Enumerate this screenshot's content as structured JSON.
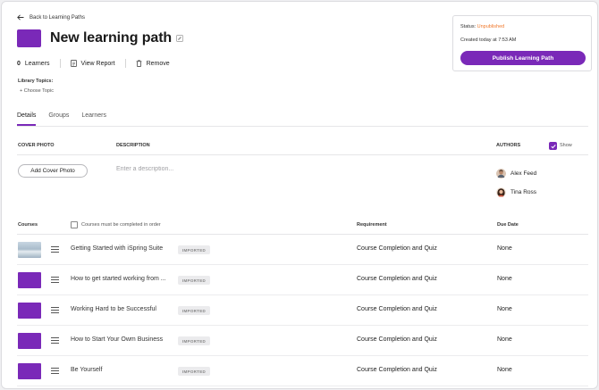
{
  "back_link": {
    "label": "Back to Learning Paths"
  },
  "title": "New learning path",
  "actions": {
    "learners_count": "0",
    "learners_label": "Learners",
    "view_report": "View Report",
    "remove": "Remove"
  },
  "library": {
    "label": "Library Topics:",
    "choose_topic": "+ Choose Topic"
  },
  "status_card": {
    "status_label": "Status:",
    "status_value": "Unpublished",
    "created": "Created today at 7:53 AM",
    "publish_button": "Publish Learning Path"
  },
  "tabs": [
    {
      "label": "Details",
      "active": true
    },
    {
      "label": "Groups",
      "active": false
    },
    {
      "label": "Learners",
      "active": false
    }
  ],
  "details": {
    "cover_photo_header": "COVER PHOTO",
    "description_header": "DESCRIPTION",
    "authors_header": "AUTHORS",
    "show_label": "Show",
    "show_checked": true,
    "add_cover_button": "Add Cover Photo",
    "description_placeholder": "Enter a description...",
    "authors": [
      {
        "name": "Alex Feed"
      },
      {
        "name": "Tina Ross"
      }
    ]
  },
  "courses": {
    "courses_header": "Courses",
    "order_checkbox_label": "Courses must be completed in order",
    "requirement_header": "Requirement",
    "due_date_header": "Due Date",
    "rows": [
      {
        "name": "Getting Started with iSpring Suite",
        "badge": "IMPORTED",
        "requirement": "Course Completion and Quiz",
        "due": "None",
        "thumb": "image"
      },
      {
        "name": "How to get started working from ...",
        "badge": "IMPORTED",
        "requirement": "Course Completion and Quiz",
        "due": "None",
        "thumb": "color"
      },
      {
        "name": "Working Hard to be Successful",
        "badge": "IMPORTED",
        "requirement": "Course Completion and Quiz",
        "due": "None",
        "thumb": "color"
      },
      {
        "name": "How to Start Your Owm Business",
        "badge": "IMPORTED",
        "requirement": "Course Completion and Quiz",
        "due": "None",
        "thumb": "color"
      },
      {
        "name": "Be Yourself",
        "badge": "IMPORTED",
        "requirement": "Course Completion and Quiz",
        "due": "None",
        "thumb": "color"
      }
    ]
  },
  "colors": {
    "accent": "#7a29b8",
    "status_unpublished": "#f0782b"
  }
}
